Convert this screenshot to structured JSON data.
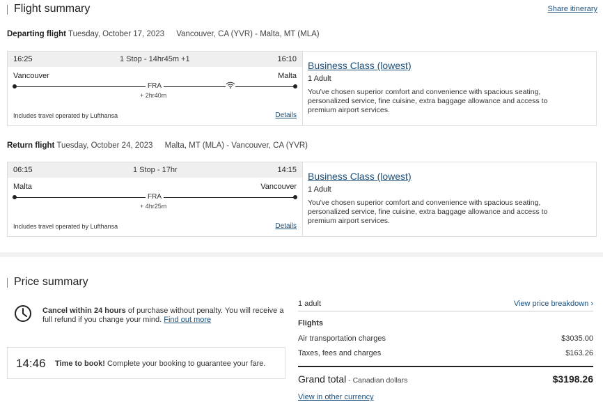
{
  "flight_summary": {
    "title": "Flight summary",
    "share_label": "Share itinerary"
  },
  "departing": {
    "label": "Departing flight",
    "date": "Tuesday, October 17, 2023",
    "route": "Vancouver, CA (YVR) - Malta, MT (MLA)",
    "dep_time": "16:25",
    "stops": "1 Stop - 14hr45m +1",
    "arr_time": "16:10",
    "from_city": "Vancouver",
    "to_city": "Malta",
    "via": "FRA",
    "layover": "+ 2hr40m",
    "ops": "Includes travel operated by Lufthansa",
    "details": "Details",
    "cabin": "Business Class (lowest)",
    "pax": "1 Adult",
    "desc": "You've chosen superior comfort and convenience with spacious seating, personalized service, fine cuisine, extra baggage allowance and access to premium airport services.",
    "wifi_icon": "wifi-icon"
  },
  "returning": {
    "label": "Return flight",
    "date": "Tuesday, October 24, 2023",
    "route": "Malta, MT (MLA) - Vancouver, CA (YVR)",
    "dep_time": "06:15",
    "stops": "1 Stop - 17hr",
    "arr_time": "14:15",
    "from_city": "Malta",
    "to_city": "Vancouver",
    "via": "FRA",
    "layover": "+ 4hr25m",
    "ops": "Includes travel operated by Lufthansa",
    "details": "Details",
    "cabin": "Business Class (lowest)",
    "pax": "1 Adult",
    "desc": "You've chosen superior comfort and convenience with spacious seating, personalized service, fine cuisine, extra baggage allowance and access to premium airport services."
  },
  "price_summary": {
    "title": "Price summary",
    "cancel_bold": "Cancel within 24 hours",
    "cancel_rest": " of purchase without penalty. You will receive a full refund if you change your mind. ",
    "find_out": "Find out more",
    "timer": "14:46",
    "timer_bold": "Time to book!",
    "timer_rest": " Complete your booking to guarantee your fare.",
    "adults": "1 adult",
    "breakdown": "View price breakdown",
    "flights_label": "Flights",
    "air_label": "Air transportation charges",
    "air_value": "$3035.00",
    "taxes_label": "Taxes, fees and charges",
    "taxes_value": "$163.26",
    "grand_label": "Grand total",
    "grand_currency": " - Canadian dollars",
    "grand_value": "$3198.26",
    "other_currency": "View in other currency"
  },
  "colors": {
    "link": "#1b4f7a",
    "strip": "#efefef",
    "border": "#dedede"
  }
}
